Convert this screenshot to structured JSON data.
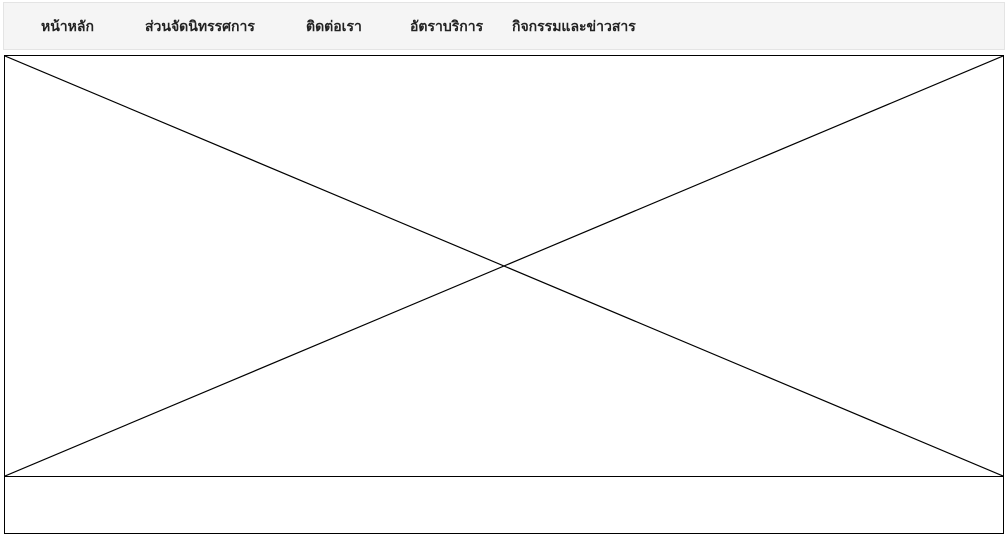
{
  "nav": {
    "items": [
      {
        "label": "หน้าหลัก"
      },
      {
        "label": "ส่วนจัดนิทรรศการ"
      },
      {
        "label": "ติดต่อเรา"
      },
      {
        "label": "อัตราบริการ"
      },
      {
        "label": "กิจกรรมและข่าวสาร"
      }
    ]
  },
  "colors": {
    "nav_background": "#f5f5f5",
    "nav_text": "#222222",
    "placeholder_stroke": "#000000"
  }
}
